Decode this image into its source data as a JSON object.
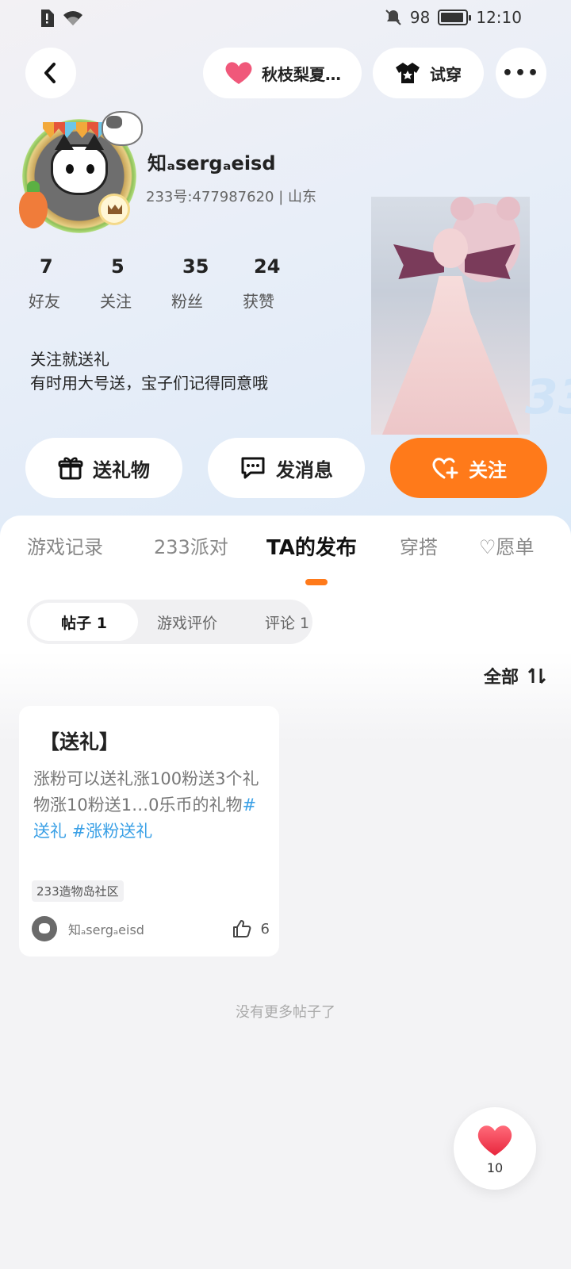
{
  "status_bar": {
    "battery": "98",
    "time": "12:10"
  },
  "topbar": {
    "room_label": "秋枝梨夏…",
    "try_on_label": "试穿",
    "more_label": "•••"
  },
  "profile": {
    "username": "知ₐsergₐeisd",
    "id_label": "233号:477987620",
    "location": "山东",
    "stats": [
      {
        "value": "7",
        "label": "好友"
      },
      {
        "value": "5",
        "label": "关注"
      },
      {
        "value": "35",
        "label": "粉丝"
      },
      {
        "value": "24",
        "label": "获赞"
      }
    ],
    "bio_line1": "关注就送礼",
    "bio_line2": "有时用大号送，宝子们记得同意哦"
  },
  "actions": {
    "gift": "送礼物",
    "message": "发消息",
    "follow": "关注"
  },
  "tabs": [
    "游戏记录",
    "233派对",
    "TA的发布",
    "穿搭",
    "♡愿单"
  ],
  "subtabs": [
    "帖子 1",
    "游戏评价",
    "评论 1"
  ],
  "sort_label": "全部",
  "post": {
    "title": "【送礼】",
    "body": "涨粉可以送礼涨100粉送3个礼物涨10粉送1…0乐币的礼物",
    "tags": "#送礼 #涨粉送礼",
    "chip": "233造物岛社区",
    "author": "知ₐsergₐeisd",
    "likes": "6"
  },
  "no_more": "没有更多帖子了",
  "fab": {
    "count": "10"
  },
  "colors": {
    "accent": "#ff7a1a",
    "tag": "#3aa0e6",
    "heart": "#f0485b"
  }
}
